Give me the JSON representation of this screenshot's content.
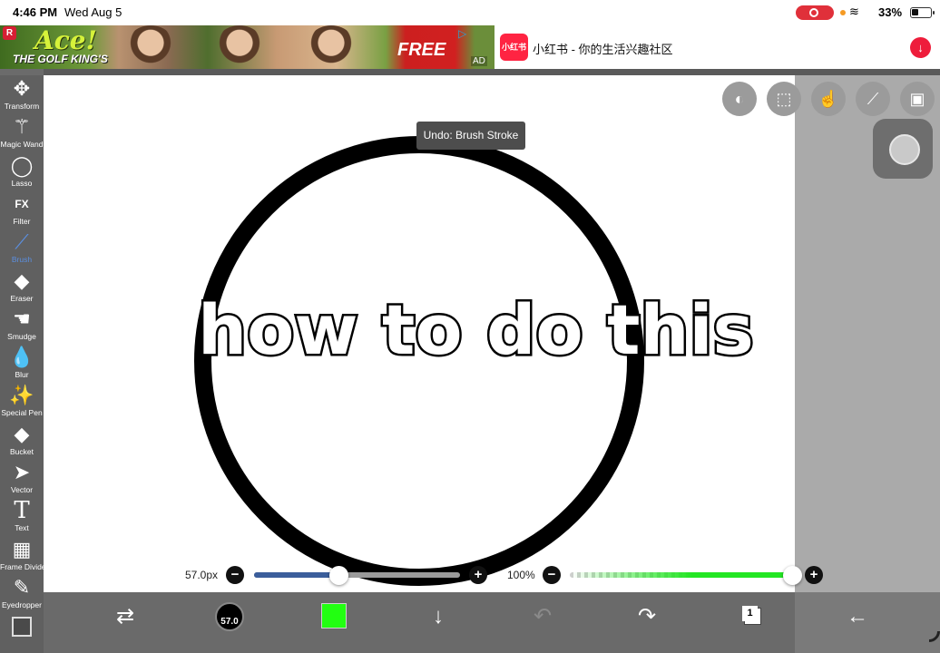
{
  "status_bar": {
    "time": "4:46 PM",
    "date": "Wed Aug 5",
    "battery_percent": "33%",
    "record_indicator_color": "#e0303a"
  },
  "ad": {
    "left_brand_badge": "R",
    "headline": "Ace!",
    "subline": "THE GOLF KING'S",
    "free_label": "FREE",
    "ad_tag": "AD",
    "app_logo_text": "小红书",
    "app_text": "小红书 - 你的生活兴趣社区",
    "download_icon": "download-arrow-icon"
  },
  "tools": [
    {
      "label": "Transform",
      "icon": "✥",
      "name": "tool-transform"
    },
    {
      "label": "Magic Wand",
      "icon": "⚚",
      "name": "tool-magic-wand"
    },
    {
      "label": "Lasso",
      "icon": "◯",
      "name": "tool-lasso"
    },
    {
      "label": "Filter",
      "icon": "FX",
      "name": "tool-filter"
    },
    {
      "label": "Brush",
      "icon": "⟋",
      "name": "tool-brush",
      "active": true
    },
    {
      "label": "Eraser",
      "icon": "◆",
      "name": "tool-eraser"
    },
    {
      "label": "Smudge",
      "icon": "☚",
      "name": "tool-smudge"
    },
    {
      "label": "Blur",
      "icon": "💧",
      "name": "tool-blur"
    },
    {
      "label": "Special Pen",
      "icon": "✨",
      "name": "tool-special-pen"
    },
    {
      "label": "Bucket",
      "icon": "◆",
      "name": "tool-bucket"
    },
    {
      "label": "Vector",
      "icon": "➤",
      "name": "tool-vector"
    },
    {
      "label": "Text",
      "icon": "T",
      "name": "tool-text"
    },
    {
      "label": "Frame Divider",
      "icon": "▦",
      "name": "tool-frame-divider"
    },
    {
      "label": "Eyedropper",
      "icon": "✎",
      "name": "tool-eyedropper"
    }
  ],
  "canvas": {
    "overlay_text": "how to do this",
    "undo_tooltip": "Undo: Brush Stroke"
  },
  "top_buttons": [
    {
      "name": "toggle-button",
      "icon": "⚙"
    },
    {
      "name": "selection-button",
      "icon": "⬚"
    },
    {
      "name": "hand-button",
      "icon": "☝"
    },
    {
      "name": "ruler-button",
      "icon": "⟋"
    },
    {
      "name": "image-button",
      "icon": "▣"
    }
  ],
  "sliders": {
    "size_label": "57.0px",
    "size_fraction": 0.41,
    "opacity_label": "100%",
    "opacity_fraction": 1.0,
    "minus_glyph": "−",
    "plus_glyph": "+"
  },
  "bottom_bar": {
    "brush_size_thumb_label": "57.0",
    "color_hex": "#22ff11",
    "layer_count": "1",
    "icons": [
      "swap-tools-icon",
      "brush-size-icon",
      "color-swatch",
      "move-down-icon",
      "undo-icon",
      "redo-icon",
      "layers-icon",
      "back-arrow-icon"
    ],
    "glyphs": {
      "swap": "⇄",
      "down": "↓",
      "undo": "↶",
      "redo": "↷",
      "back": "←"
    }
  }
}
